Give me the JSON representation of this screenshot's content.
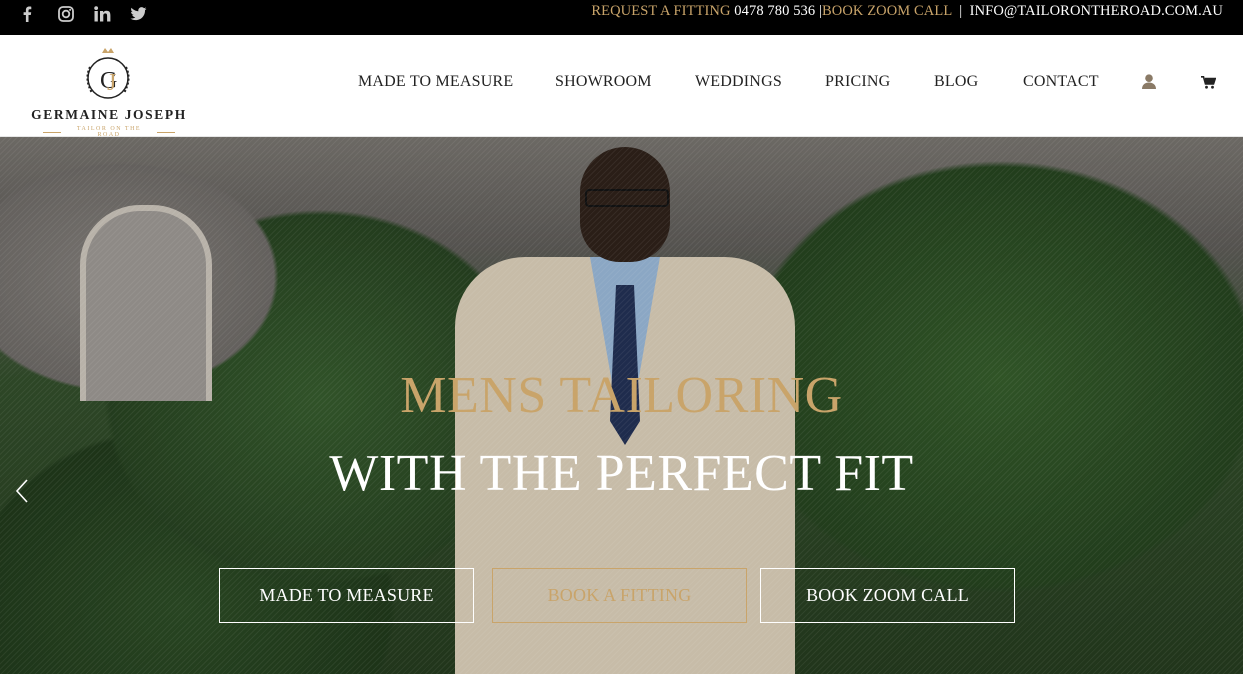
{
  "topbar": {
    "social": [
      "facebook-icon",
      "instagram-icon",
      "linkedin-icon",
      "twitter-icon"
    ],
    "request_label": "REQUEST A FITTING",
    "phone": "0478 780 536",
    "sep1": "|",
    "zoom_label": "BOOK ZOOM CALL",
    "sep2": "|",
    "email": "INFO@TAILORONTHEROAD.COM.AU"
  },
  "logo": {
    "monogram": "GJ",
    "name": "GERMAINE JOSEPH",
    "tagline": "TAILOR ON THE ROAD"
  },
  "nav": {
    "items": [
      "MADE TO MEASURE",
      "SHOWROOM",
      "WEDDINGS",
      "PRICING",
      "BLOG",
      "CONTACT"
    ],
    "account_icon": "user-icon",
    "cart_icon": "cart-icon"
  },
  "hero": {
    "title_line1": "MENS TAILORING",
    "title_line2": "WITH THE PERFECT FIT",
    "buttons": [
      "MADE TO MEASURE",
      "BOOK A FITTING",
      "BOOK ZOOM CALL"
    ],
    "prev_icon": "chevron-left-icon"
  },
  "colors": {
    "accent_gold": "#c9a46a",
    "topbar_bg": "#000000",
    "text_dark": "#222222"
  }
}
